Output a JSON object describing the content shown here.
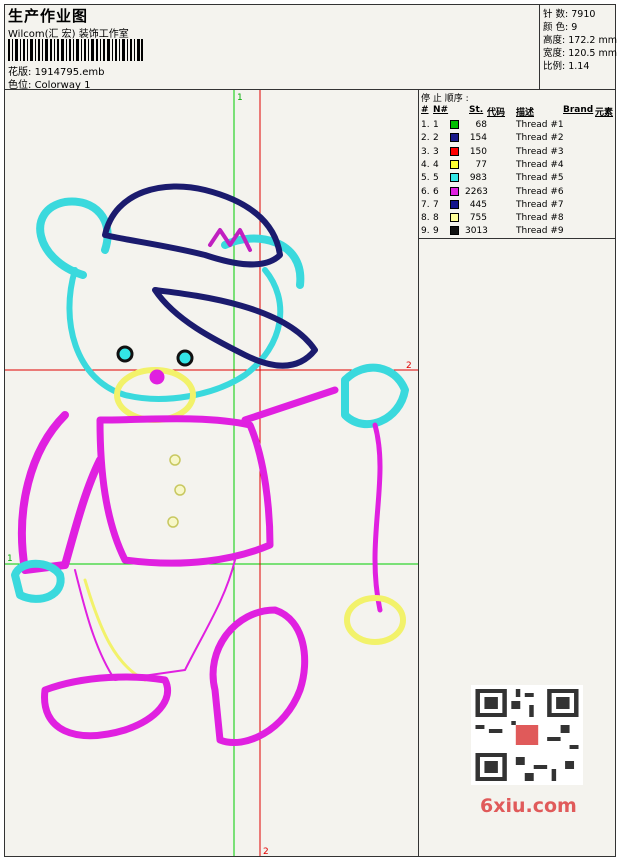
{
  "header": {
    "title": "生产作业图",
    "studio": "Wilcom(汇 宏) 装饰工作室",
    "design_label": "花版:",
    "design_value": "1914795.emb",
    "colorway_label": "色位:",
    "colorway_value": "Colorway 1"
  },
  "stats": {
    "stitches_label": "针 数:",
    "stitches_value": "7910",
    "colors_label": "颜 色:",
    "colors_value": "9",
    "height_label": "高度:",
    "height_value": "172.2 mm",
    "width_label": "宽度:",
    "width_value": "120.5 mm",
    "ratio_label": "比例:",
    "ratio_value": "1.14"
  },
  "sequence": {
    "title": "停 止 顺序 :",
    "headers": {
      "num": "#",
      "n": "N#",
      "st": "St.",
      "code": "代码",
      "desc": "描述",
      "brand": "Brand",
      "element": "元素"
    },
    "rows": [
      {
        "num": "1.",
        "n": "1",
        "color": "#00c000",
        "st": "68",
        "desc": "Thread #1"
      },
      {
        "num": "2.",
        "n": "2",
        "color": "#1b1b8a",
        "st": "154",
        "desc": "Thread #2"
      },
      {
        "num": "3.",
        "n": "3",
        "color": "#ff0000",
        "st": "150",
        "desc": "Thread #3"
      },
      {
        "num": "4.",
        "n": "4",
        "color": "#ffff33",
        "st": "77",
        "desc": "Thread #4"
      },
      {
        "num": "5.",
        "n": "5",
        "color": "#33e6e6",
        "st": "983",
        "desc": "Thread #5"
      },
      {
        "num": "6.",
        "n": "6",
        "color": "#e020e0",
        "st": "2263",
        "desc": "Thread #6"
      },
      {
        "num": "7.",
        "n": "7",
        "color": "#14148c",
        "st": "445",
        "desc": "Thread #7"
      },
      {
        "num": "8.",
        "n": "8",
        "color": "#ffff99",
        "st": "755",
        "desc": "Thread #8"
      },
      {
        "num": "9.",
        "n": "9",
        "color": "#111111",
        "st": "3013",
        "desc": "Thread #9"
      }
    ]
  },
  "axes": {
    "green_label": "1",
    "red_label": "2"
  },
  "watermark": "6xiu.com",
  "colors": {
    "green": "#00cc00",
    "red": "#e00000",
    "pink": "#e020e0",
    "cyan": "#3ad9dd",
    "navy": "#1b1b6e",
    "yellow": "#f2f26a"
  }
}
